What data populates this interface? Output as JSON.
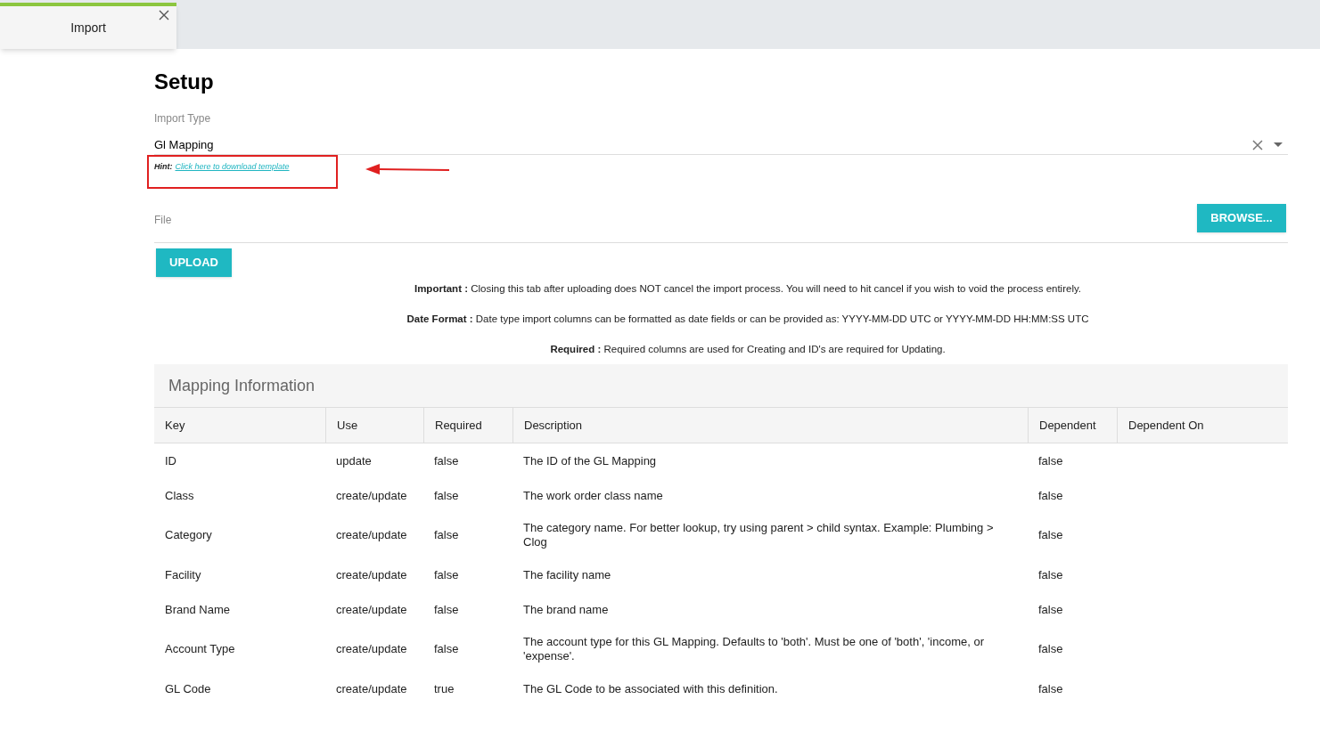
{
  "tabs": [
    {
      "label": "Import",
      "selected": true
    }
  ],
  "title": "Setup",
  "import_type": {
    "label": "Import Type",
    "value": "Gl Mapping",
    "hint_label": "Hint:",
    "hint_link": "Click here to download template"
  },
  "file": {
    "label": "File",
    "browse_button": "BROWSE..."
  },
  "upload_button": "UPLOAD",
  "notes": [
    "**Important :** Closing this tab after uploading does NOT cancel the import process. You will need to hit cancel if you wish to void the process entirely.",
    "**Date Format :** Date type import columns can be formatted as date fields or can be provided as: YYYY-MM-DD UTC or YYYY-MM-DD HH:MM:SS UTC",
    "**Required :** Required columns are used for Creating and ID's are required for Updating."
  ],
  "mapping": {
    "title": "Mapping Information",
    "columns": [
      "Key",
      "Use",
      "Required",
      "Description",
      "Dependent",
      "Dependent On"
    ],
    "rows": [
      [
        "ID",
        "update",
        "false",
        "The ID of the GL Mapping",
        "false",
        ""
      ],
      [
        "Class",
        "create/update",
        "false",
        "The work order class name",
        "false",
        ""
      ],
      [
        "Category",
        "create/update",
        "false",
        "The category name. For better lookup, try using parent > child syntax. Example: Plumbing > Clog",
        "false",
        ""
      ],
      [
        "Facility",
        "create/update",
        "false",
        "The facility name",
        "false",
        ""
      ],
      [
        "Brand Name",
        "create/update",
        "false",
        "The brand name",
        "false",
        ""
      ],
      [
        "Account Type",
        "create/update",
        "false",
        "The account type for this GL Mapping. Defaults to 'both'. Must be one of 'both', 'income, or 'expense'.",
        "false",
        ""
      ],
      [
        "GL Code",
        "create/update",
        "true",
        "The GL Code to be associated with this definition.",
        "false",
        ""
      ]
    ]
  }
}
